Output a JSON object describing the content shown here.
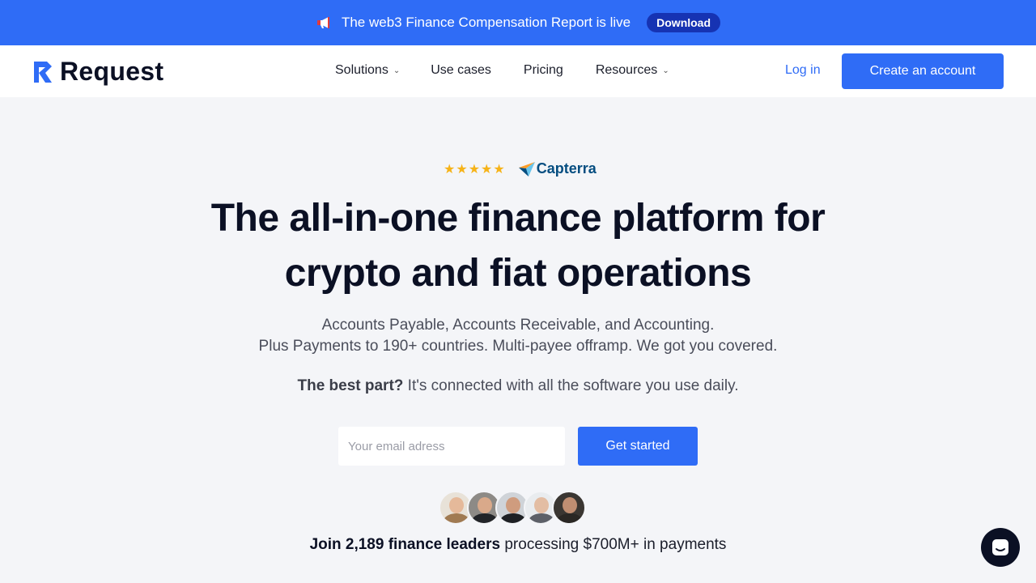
{
  "banner": {
    "icon": "megaphone-icon",
    "text": "The web3 Finance Compensation Report is live",
    "button": "Download",
    "color": "#2f6cf6"
  },
  "nav": {
    "logo_text": "Request",
    "items": [
      {
        "label": "Solutions",
        "has_dropdown": true
      },
      {
        "label": "Use cases",
        "has_dropdown": false
      },
      {
        "label": "Pricing",
        "has_dropdown": false
      },
      {
        "label": "Resources",
        "has_dropdown": true
      }
    ],
    "login": "Log in",
    "cta": "Create an account"
  },
  "hero": {
    "rating_stars": 5,
    "rating_source": "Capterra",
    "title_line1": "The all-in-one finance platform for",
    "title_line2": "crypto and fiat operations",
    "sub_line1": "Accounts Payable, Accounts Receivable, and Accounting.",
    "sub_line2": "Plus Payments to 190+ countries. Multi-payee offramp. We got you covered.",
    "best_bold": "The best part?",
    "best_rest": " It's connected with all the software you use daily.",
    "email_placeholder": "Your email adress",
    "cta": "Get started",
    "join_bold": "Join 2,189 finance leaders",
    "join_rest": " processing $700M+ in payments"
  },
  "colors": {
    "accent": "#2f6cf6",
    "dark": "#0b1024",
    "background": "#f4f5f8"
  }
}
